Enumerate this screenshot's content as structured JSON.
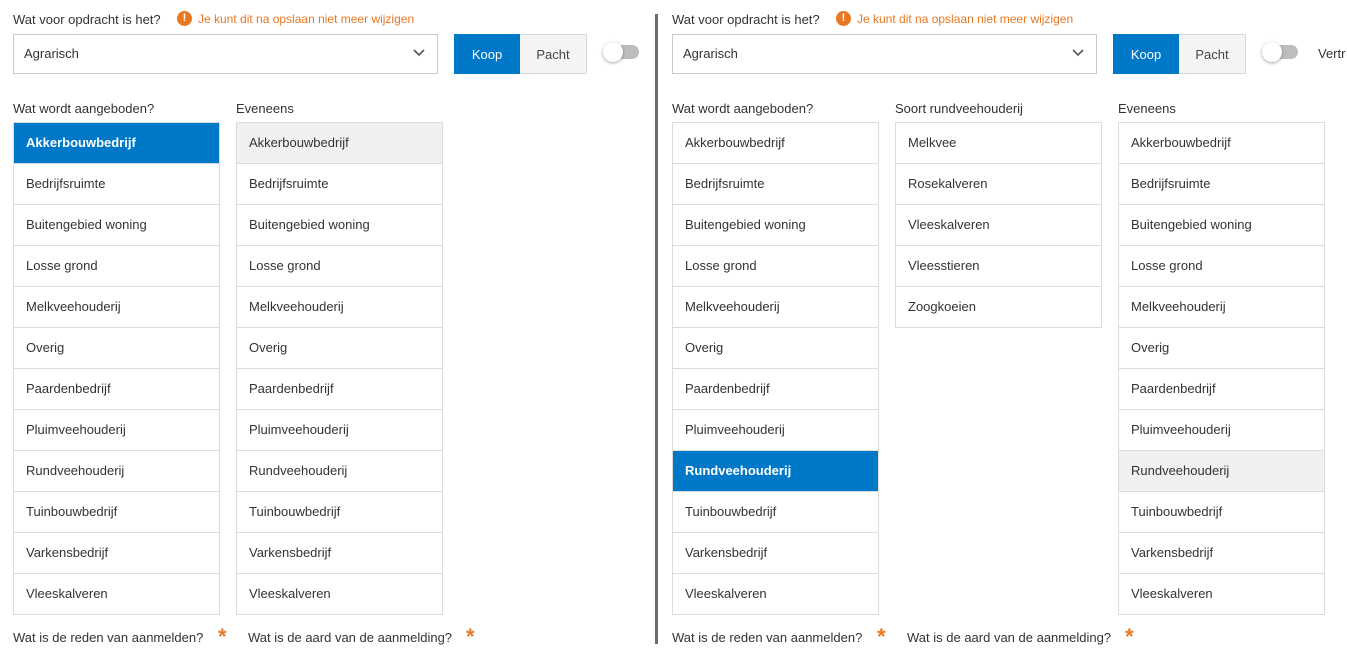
{
  "colors": {
    "accent": "#0078c8",
    "warning": "#e87722"
  },
  "left": {
    "question": "Wat voor opdracht is het?",
    "warning": "Je kunt dit na opslaan niet meer wijzigen",
    "warning_icon": "!",
    "select_value": "Agrarisch",
    "segment": {
      "koop": "Koop",
      "pacht": "Pacht",
      "selected": "Koop"
    },
    "toggle_on": false,
    "offered_header": "Wat wordt aangeboden?",
    "also_header": "Eveneens",
    "offered_items": [
      "Akkerbouwbedrijf",
      "Bedrijfsruimte",
      "Buitengebied woning",
      "Losse grond",
      "Melkveehouderij",
      "Overig",
      "Paardenbedrijf",
      "Pluimveehouderij",
      "Rundveehouderij",
      "Tuinbouwbedrijf",
      "Varkensbedrijf",
      "Vleeskalveren"
    ],
    "offered_selected": "Akkerbouwbedrijf",
    "also_items": [
      "Akkerbouwbedrijf",
      "Bedrijfsruimte",
      "Buitengebied woning",
      "Losse grond",
      "Melkveehouderij",
      "Overig",
      "Paardenbedrijf",
      "Pluimveehouderij",
      "Rundveehouderij",
      "Tuinbouwbedrijf",
      "Varkensbedrijf",
      "Vleeskalveren"
    ],
    "also_disabled": "Akkerbouwbedrijf",
    "reason_label": "Wat is de reden van aanmelden?",
    "nature_label": "Wat is de aard van de aanmelding?",
    "required_mark": "*"
  },
  "right": {
    "question": "Wat voor opdracht is het?",
    "warning": "Je kunt dit na opslaan niet meer wijzigen",
    "warning_icon": "!",
    "select_value": "Agrarisch",
    "segment": {
      "koop": "Koop",
      "pacht": "Pacht",
      "selected": "Koop"
    },
    "toggle_on": false,
    "toggle_label": "Vertr",
    "offered_header": "Wat wordt aangeboden?",
    "sub_header": "Soort rundveehouderij",
    "also_header": "Eveneens",
    "offered_items": [
      "Akkerbouwbedrijf",
      "Bedrijfsruimte",
      "Buitengebied woning",
      "Losse grond",
      "Melkveehouderij",
      "Overig",
      "Paardenbedrijf",
      "Pluimveehouderij",
      "Rundveehouderij",
      "Tuinbouwbedrijf",
      "Varkensbedrijf",
      "Vleeskalveren"
    ],
    "offered_selected": "Rundveehouderij",
    "sub_items": [
      "Melkvee",
      "Rosekalveren",
      "Vleeskalveren",
      "Vleesstieren",
      "Zoogkoeien"
    ],
    "also_items": [
      "Akkerbouwbedrijf",
      "Bedrijfsruimte",
      "Buitengebied woning",
      "Losse grond",
      "Melkveehouderij",
      "Overig",
      "Paardenbedrijf",
      "Pluimveehouderij",
      "Rundveehouderij",
      "Tuinbouwbedrijf",
      "Varkensbedrijf",
      "Vleeskalveren"
    ],
    "also_disabled": "Rundveehouderij",
    "reason_label": "Wat is de reden van aanmelden?",
    "nature_label": "Wat is de aard van de aanmelding?",
    "required_mark": "*"
  }
}
